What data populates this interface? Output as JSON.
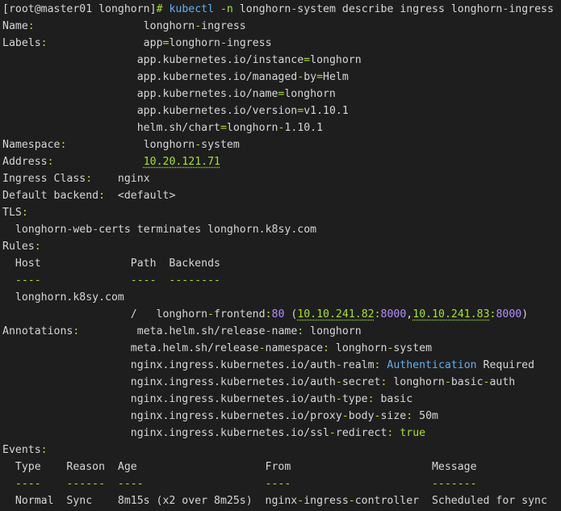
{
  "lines": [
    [
      [
        "[root@master01 longhorn]",
        "def"
      ],
      [
        "# ",
        "grn"
      ],
      [
        "kubectl",
        "blu"
      ],
      [
        " ",
        "def"
      ],
      [
        "-n",
        "grn"
      ],
      [
        " longhorn",
        "def"
      ],
      [
        "-",
        "grn"
      ],
      [
        "system describe ingress longhorn",
        "def"
      ],
      [
        "-",
        "grn"
      ],
      [
        "ingress",
        "def"
      ]
    ],
    [
      [
        "Name",
        "def"
      ],
      [
        ":",
        "grn"
      ],
      [
        "                 longhorn",
        "def"
      ],
      [
        "-",
        "grn"
      ],
      [
        "ingress",
        "def"
      ]
    ],
    [
      [
        "Labels",
        "def"
      ],
      [
        ":",
        "grn"
      ],
      [
        "               app",
        "def"
      ],
      [
        "=",
        "grn"
      ],
      [
        "longhorn",
        "def"
      ],
      [
        "-",
        "grn"
      ],
      [
        "ingress",
        "def"
      ]
    ],
    [
      [
        "                     app.kubernetes.io/instance",
        "def"
      ],
      [
        "=",
        "grn"
      ],
      [
        "longhorn",
        "def"
      ]
    ],
    [
      [
        "                     app.kubernetes.io/managed",
        "def"
      ],
      [
        "-",
        "grn"
      ],
      [
        "by",
        "def"
      ],
      [
        "=",
        "grn"
      ],
      [
        "Helm",
        "def"
      ]
    ],
    [
      [
        "                     app.kubernetes.io/name",
        "def"
      ],
      [
        "=",
        "grn"
      ],
      [
        "longhorn",
        "def"
      ]
    ],
    [
      [
        "                     app.kubernetes.io/version",
        "def"
      ],
      [
        "=",
        "grn"
      ],
      [
        "v1.10.1",
        "def"
      ]
    ],
    [
      [
        "                     helm.sh/chart",
        "def"
      ],
      [
        "=",
        "grn"
      ],
      [
        "longhorn",
        "def"
      ],
      [
        "-",
        "grn"
      ],
      [
        "1.10.1",
        "def"
      ]
    ],
    [
      [
        "Namespace",
        "def"
      ],
      [
        ":",
        "grn"
      ],
      [
        "            longhorn",
        "def"
      ],
      [
        "-",
        "grn"
      ],
      [
        "system",
        "def"
      ]
    ],
    [
      [
        "Address",
        "def"
      ],
      [
        ":",
        "grn"
      ],
      [
        "              ",
        "def"
      ],
      [
        "10.20.121.71",
        "grn",
        "u"
      ]
    ],
    [
      [
        "Ingress Class",
        "def"
      ],
      [
        ":",
        "grn"
      ],
      [
        "    nginx",
        "def"
      ]
    ],
    [
      [
        "Default backend",
        "def"
      ],
      [
        ":",
        "grn"
      ],
      [
        "  <default>",
        "def"
      ]
    ],
    [
      [
        "TLS",
        "def"
      ],
      [
        ":",
        "grn"
      ]
    ],
    [
      [
        "  longhorn",
        "def"
      ],
      [
        "-",
        "grn"
      ],
      [
        "web",
        "def"
      ],
      [
        "-",
        "grn"
      ],
      [
        "certs terminates longhorn.k8sy.com",
        "def"
      ]
    ],
    [
      [
        "Rules",
        "def"
      ],
      [
        ":",
        "grn"
      ]
    ],
    [
      [
        "  Host              Path  Backends",
        "def"
      ]
    ],
    [
      [
        "  ----              ----  --------",
        "grn"
      ]
    ],
    [
      [
        "  longhorn.k8sy.com",
        "def"
      ]
    ],
    [
      [
        "                    /   longhorn",
        "def"
      ],
      [
        "-",
        "grn"
      ],
      [
        "frontend",
        "def"
      ],
      [
        ":",
        "grn"
      ],
      [
        "80",
        "pur"
      ],
      [
        " (",
        "def"
      ],
      [
        "10.10.241.82",
        "grn",
        "u"
      ],
      [
        ":",
        "grn"
      ],
      [
        "8000",
        "pur"
      ],
      [
        ",",
        "def"
      ],
      [
        "10.10.241.83",
        "grn",
        "u"
      ],
      [
        ":",
        "grn"
      ],
      [
        "8000",
        "pur"
      ],
      [
        ")",
        "def"
      ]
    ],
    [
      [
        "Annotations",
        "def"
      ],
      [
        ":",
        "grn"
      ],
      [
        "         meta.helm.sh/release",
        "def"
      ],
      [
        "-",
        "grn"
      ],
      [
        "name",
        "def"
      ],
      [
        ":",
        "grn"
      ],
      [
        " longhorn",
        "def"
      ]
    ],
    [
      [
        "                    meta.helm.sh/release",
        "def"
      ],
      [
        "-",
        "grn"
      ],
      [
        "namespace",
        "def"
      ],
      [
        ":",
        "grn"
      ],
      [
        " longhorn",
        "def"
      ],
      [
        "-",
        "grn"
      ],
      [
        "system",
        "def"
      ]
    ],
    [
      [
        "                    nginx.ingress.kubernetes.io/auth",
        "def"
      ],
      [
        "-",
        "grn"
      ],
      [
        "realm",
        "def"
      ],
      [
        ":",
        "grn"
      ],
      [
        " ",
        "def"
      ],
      [
        "Authentication",
        "blu"
      ],
      [
        " Required",
        "def"
      ]
    ],
    [
      [
        "                    nginx.ingress.kubernetes.io/auth",
        "def"
      ],
      [
        "-",
        "grn"
      ],
      [
        "secret",
        "def"
      ],
      [
        ":",
        "grn"
      ],
      [
        " longhorn",
        "def"
      ],
      [
        "-",
        "grn"
      ],
      [
        "basic",
        "def"
      ],
      [
        "-",
        "grn"
      ],
      [
        "auth",
        "def"
      ]
    ],
    [
      [
        "                    nginx.ingress.kubernetes.io/auth",
        "def"
      ],
      [
        "-",
        "grn"
      ],
      [
        "type",
        "def"
      ],
      [
        ":",
        "grn"
      ],
      [
        " basic",
        "def"
      ]
    ],
    [
      [
        "                    nginx.ingress.kubernetes.io/proxy",
        "def"
      ],
      [
        "-",
        "grn"
      ],
      [
        "body",
        "def"
      ],
      [
        "-",
        "grn"
      ],
      [
        "size",
        "def"
      ],
      [
        ":",
        "grn"
      ],
      [
        " 50m",
        "def"
      ]
    ],
    [
      [
        "                    nginx.ingress.kubernetes.io/ssl",
        "def"
      ],
      [
        "-",
        "grn"
      ],
      [
        "redirect",
        "def"
      ],
      [
        ":",
        "grn"
      ],
      [
        " ",
        "def"
      ],
      [
        "true",
        "grn"
      ]
    ],
    [
      [
        "Events",
        "def"
      ],
      [
        ":",
        "grn"
      ]
    ],
    [
      [
        "  Type    Reason  Age                    From                      Message",
        "def"
      ]
    ],
    [
      [
        "  ----    ------  ----                   ----                      -------",
        "grn"
      ]
    ],
    [
      [
        "  Normal  Sync    8m15s (x2 over 8m25s)  nginx",
        "def"
      ],
      [
        "-",
        "grn"
      ],
      [
        "ingress",
        "def"
      ],
      [
        "-",
        "grn"
      ],
      [
        "controller  Scheduled for sync",
        "def"
      ]
    ]
  ],
  "colors": {
    "def": "#d6d6d6",
    "grn": "#a6e22e",
    "blu": "#61afef",
    "pur": "#b48cff",
    "background": "#1e1e1e"
  }
}
